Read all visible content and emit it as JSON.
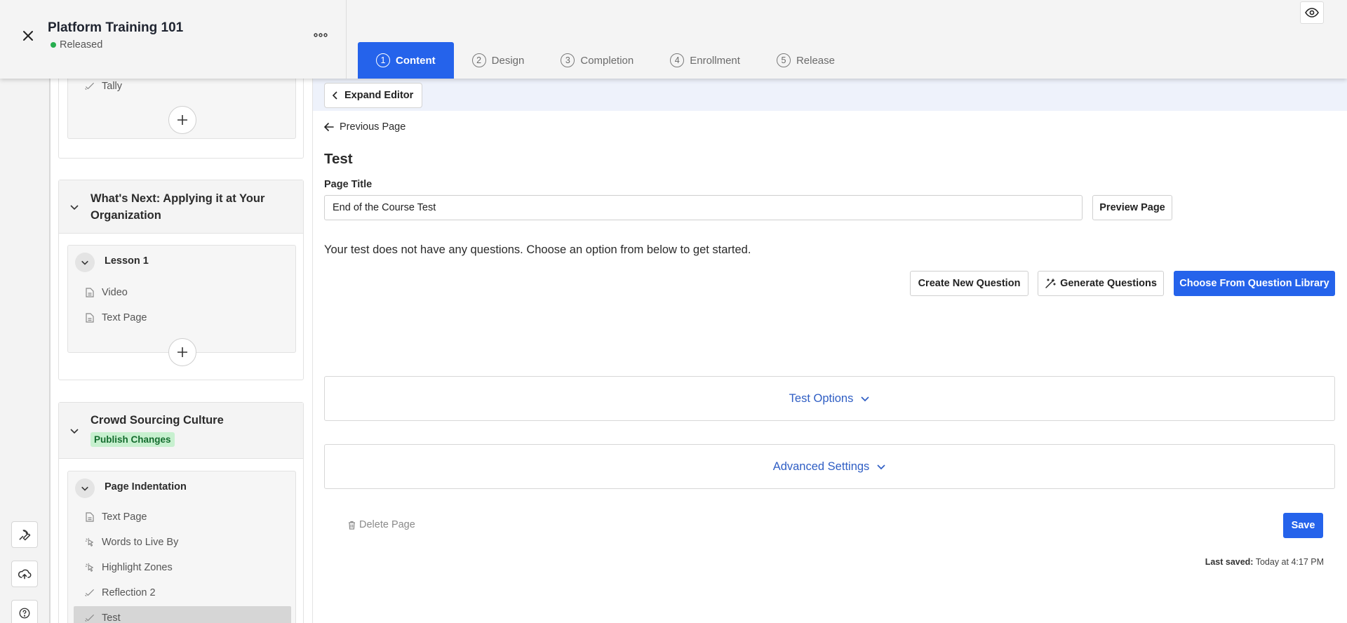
{
  "header": {
    "course_title": "Platform Training 101",
    "course_status": "Released",
    "status_color": "#27ae4f",
    "accent_color": "#2563eb"
  },
  "tabs": [
    {
      "num": "1",
      "label": "Content",
      "active": true
    },
    {
      "num": "2",
      "label": "Design",
      "active": false
    },
    {
      "num": "3",
      "label": "Completion",
      "active": false
    },
    {
      "num": "4",
      "label": "Enrollment",
      "active": false
    },
    {
      "num": "5",
      "label": "Release",
      "active": false
    }
  ],
  "outline": {
    "section0": {
      "items": [
        {
          "label": "Tally",
          "icon": "check-icon"
        }
      ]
    },
    "section1": {
      "title": "What's Next: Applying it at Your Organization",
      "lesson": {
        "title": "Lesson 1",
        "items": [
          {
            "label": "Video",
            "icon": "page-icon"
          },
          {
            "label": "Text Page",
            "icon": "page-icon"
          }
        ]
      }
    },
    "section2": {
      "title": "Crowd Sourcing Culture",
      "badge": "Publish Changes",
      "lesson": {
        "title": "Page Indentation",
        "items": [
          {
            "label": "Text Page",
            "icon": "page-icon"
          },
          {
            "label": "Words to Live By",
            "icon": "interaction-icon"
          },
          {
            "label": "Highlight Zones",
            "icon": "interaction-icon"
          },
          {
            "label": "Reflection 2",
            "icon": "check-icon"
          },
          {
            "label": "Test",
            "icon": "check-icon",
            "active": true
          }
        ]
      }
    }
  },
  "rail": [
    "wrench-icon",
    "cloud-upload-icon",
    "help-icon"
  ],
  "editor": {
    "expand_label": "Expand Editor",
    "previous_page": "Previous Page",
    "page_heading": "Test",
    "page_title_label": "Page Title",
    "page_title_value": "End of the Course Test",
    "preview_label": "Preview Page",
    "empty_message": "Your test does not have any questions. Choose an option from below to get started.",
    "create_question": "Create New Question",
    "generate_questions": "Generate Questions",
    "choose_library": "Choose From Question Library",
    "test_options": "Test Options",
    "advanced_settings": "Advanced Settings",
    "delete_page": "Delete Page",
    "save": "Save",
    "last_saved_label": "Last saved:",
    "last_saved_value": "Today at 4:17 PM"
  }
}
